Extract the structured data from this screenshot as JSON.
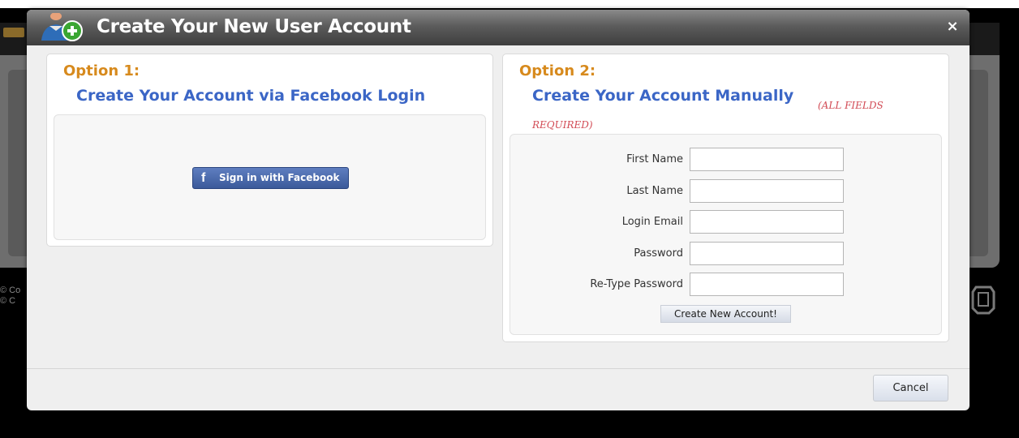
{
  "dialog": {
    "title": "Create Your New User Account",
    "close_symbol": "×",
    "cancel_label": "Cancel"
  },
  "option1": {
    "label": "Option 1:",
    "heading": "Create Your Account via Facebook Login",
    "facebook_button_label": "Sign in with Facebook",
    "facebook_icon_glyph": "f"
  },
  "option2": {
    "label": "Option 2:",
    "heading": "Create Your Account Manually",
    "required_note_line1": "(ALL FIELDS",
    "required_note_line2": "REQUIRED)",
    "fields": [
      {
        "label": "First Name",
        "value": ""
      },
      {
        "label": "Last Name",
        "value": ""
      },
      {
        "label": "Login Email",
        "value": ""
      },
      {
        "label": "Password",
        "value": ""
      },
      {
        "label": "Re-Type Password",
        "value": ""
      }
    ],
    "submit_label": "Create New Account!"
  },
  "background": {
    "copyright_line1": "© Co",
    "copyright_line2": "© C"
  },
  "colors": {
    "option_label": "#d78a1d",
    "heading": "#3b66c6",
    "required_note": "#d24b55",
    "facebook_blue": "#3b5a9a"
  },
  "icons": {
    "title_icon": "add-user-icon",
    "close_icon": "close-icon",
    "facebook_icon": "facebook-icon",
    "bg_logo": "logo-icon"
  }
}
